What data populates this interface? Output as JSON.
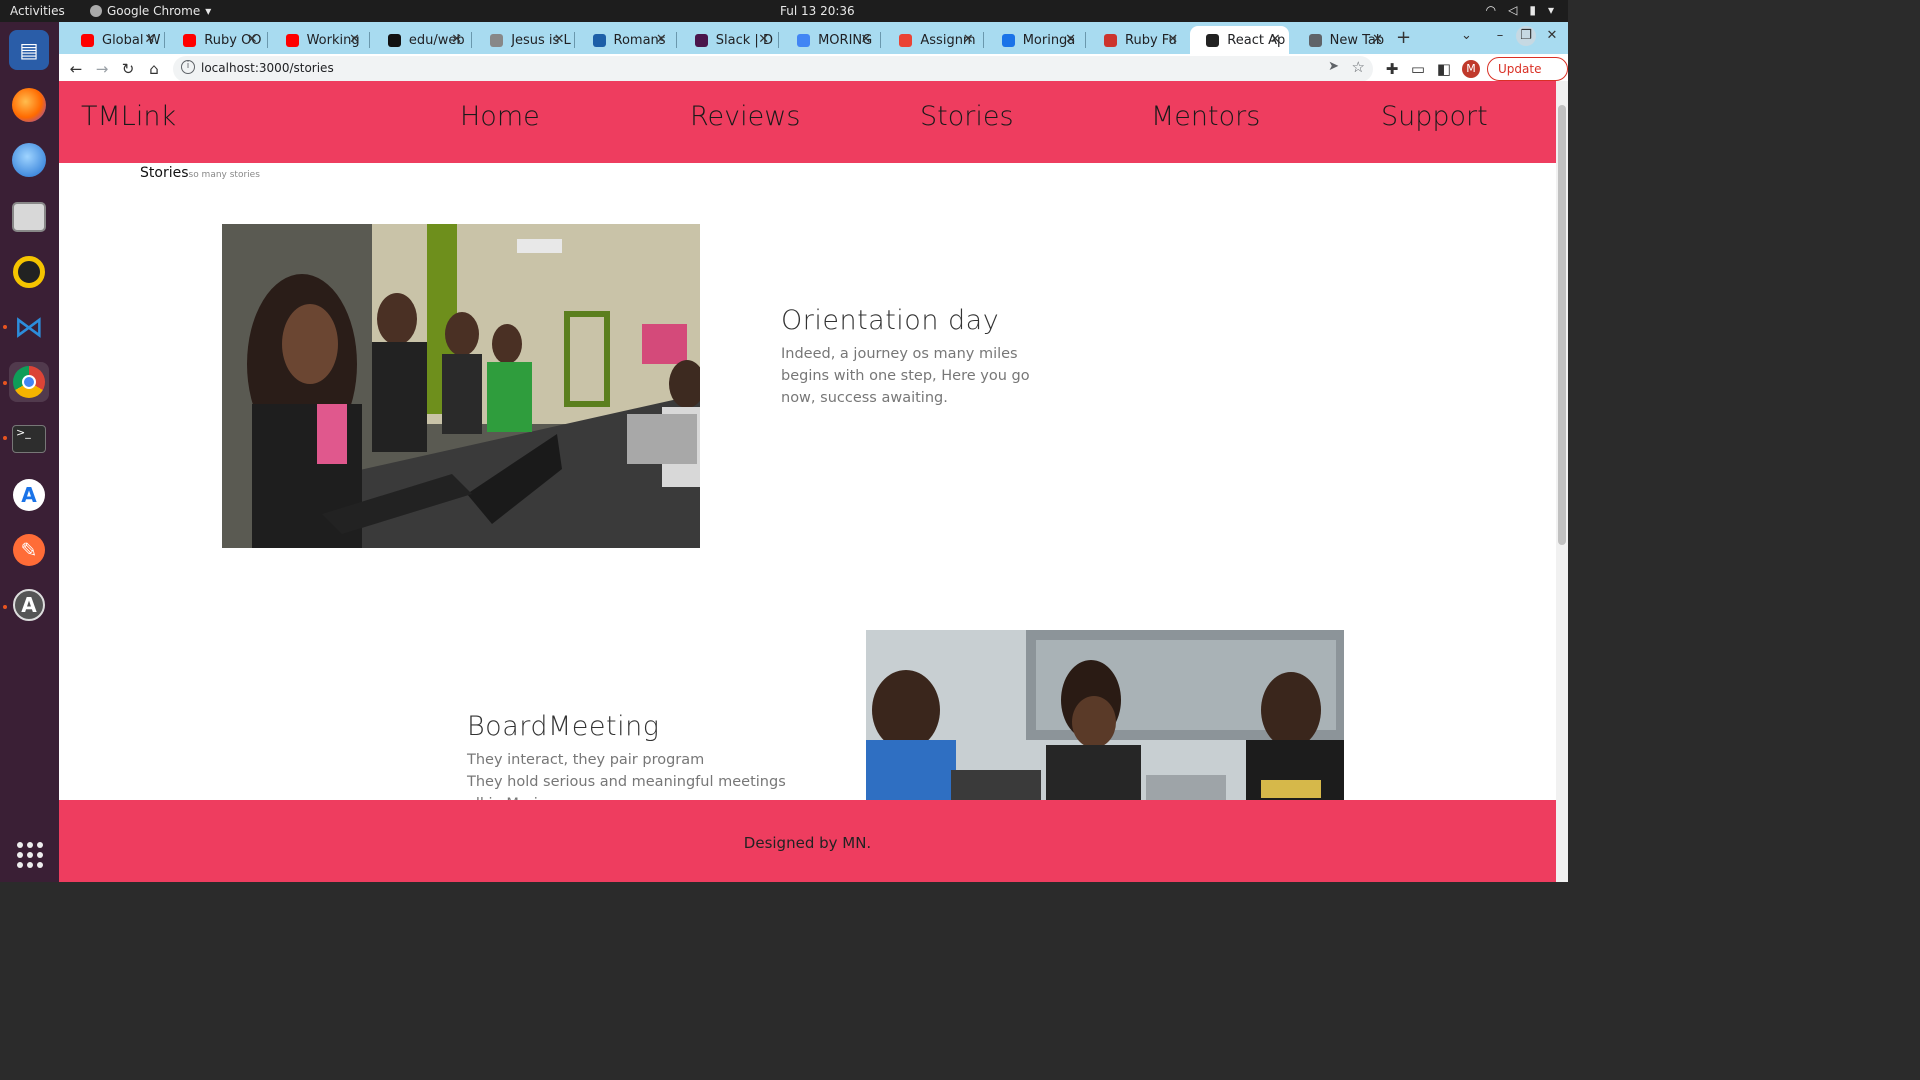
{
  "system": {
    "activities": "Activities",
    "app_name": "Google Chrome",
    "clock": "Ful 13  20:36"
  },
  "dock": {
    "apps": [
      "libreoffice-writer-icon",
      "firefox-icon",
      "thunderbird-icon",
      "files-icon",
      "rhythmbox-icon",
      "vscode-icon",
      "chrome-icon",
      "terminal-icon",
      "android-studio-icon",
      "postman-icon",
      "software-updater-icon"
    ]
  },
  "browser": {
    "tabs": [
      {
        "title": "Global W",
        "favicon_color": "#ff0000"
      },
      {
        "title": "Ruby OO",
        "favicon_color": "#ff0000"
      },
      {
        "title": "Working",
        "favicon_color": "#ff0000"
      },
      {
        "title": "edu/web",
        "favicon_color": "#111111"
      },
      {
        "title": "Jesus is L",
        "favicon_color": "#888888"
      },
      {
        "title": "Romans",
        "favicon_color": "#1d5fa8"
      },
      {
        "title": "Slack | D",
        "favicon_color": "#4a154b"
      },
      {
        "title": "MORING",
        "favicon_color": "#4285f4"
      },
      {
        "title": "Assignm",
        "favicon_color": "#ea4335"
      },
      {
        "title": "Moringa",
        "favicon_color": "#1a73e8"
      },
      {
        "title": "Ruby Fu",
        "favicon_color": "#cc342d"
      },
      {
        "title": "React Ap",
        "favicon_color": "#222222",
        "active": true
      },
      {
        "title": "New Tab",
        "favicon_color": "#5f6368"
      }
    ],
    "url": "localhost:3000/stories",
    "profile_initial": "M",
    "update_label": "Update"
  },
  "site": {
    "brand": "TMLink",
    "nav": [
      "Home",
      "Reviews",
      "Stories",
      "Mentors",
      "Support"
    ],
    "breadcrumb": "Stories",
    "breadcrumb_sub": "so many stories",
    "stories": [
      {
        "title": "Orientation day",
        "lines": [
          "Indeed, a journey os many miles",
          "begins with one step, Here you go",
          "now, success awaiting."
        ]
      },
      {
        "title": "BoardMeeting",
        "lines": [
          "They interact, they pair program",
          "They hold serious and meaningful meetings",
          "all in Moringa"
        ]
      }
    ],
    "footer": "Designed by MN."
  },
  "colors": {
    "brand_pink": "#ee3d5f",
    "tabstrip": "#a8dbf0"
  }
}
